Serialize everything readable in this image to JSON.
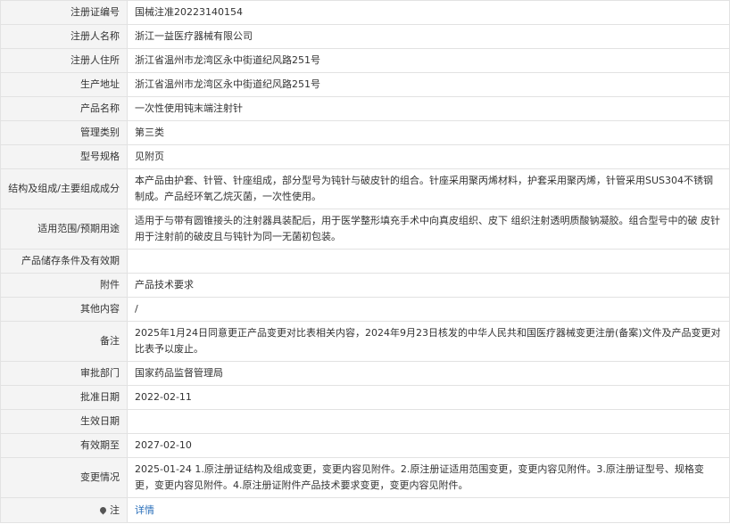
{
  "rows": [
    {
      "label": "注册证编号",
      "value": "国械注准20223140154"
    },
    {
      "label": "注册人名称",
      "value": "浙江一益医疗器械有限公司"
    },
    {
      "label": "注册人住所",
      "value": "浙江省温州市龙湾区永中街道纪风路251号"
    },
    {
      "label": "生产地址",
      "value": "浙江省温州市龙湾区永中街道纪风路251号"
    },
    {
      "label": "产品名称",
      "value": "一次性使用钝末端注射针"
    },
    {
      "label": "管理类别",
      "value": "第三类"
    },
    {
      "label": "型号规格",
      "value": "见附页"
    },
    {
      "label": "结构及组成/主要组成成分",
      "value": "本产品由护套、针管、针座组成，部分型号为钝针与破皮针的组合。针座采用聚丙烯材料，护套采用聚丙烯，针管采用SUS304不锈钢制成。产品经环氧乙烷灭菌，一次性使用。"
    },
    {
      "label": "适用范围/预期用途",
      "value": "适用于与带有圆锥接头的注射器具装配后，用于医学整形填充手术中向真皮组织、皮下 组织注射透明质酸钠凝胶。组合型号中的破 皮针用于注射前的破皮且与钝针为同一无菌初包装。"
    },
    {
      "label": "产品储存条件及有效期",
      "value": ""
    },
    {
      "label": "附件",
      "value": "产品技术要求"
    },
    {
      "label": "其他内容",
      "value": "/"
    },
    {
      "label": "备注",
      "value": "2025年1月24日同意更正产品变更对比表相关内容，2024年9月23日核发的中华人民共和国医疗器械变更注册(备案)文件及产品变更对比表予以废止。"
    },
    {
      "label": "审批部门",
      "value": "国家药品监督管理局"
    },
    {
      "label": "批准日期",
      "value": "2022-02-11"
    },
    {
      "label": "生效日期",
      "value": ""
    },
    {
      "label": "有效期至",
      "value": "2027-02-10"
    },
    {
      "label": "变更情况",
      "value": "2025-01-24 1.原注册证结构及组成变更，变更内容见附件。2.原注册证适用范围变更，变更内容见附件。3.原注册证型号、规格变更，变更内容见附件。4.原注册证附件产品技术要求变更，变更内容见附件。"
    }
  ],
  "note": {
    "label": "注",
    "link_text": "详情",
    "icon": "map-pin-icon"
  }
}
